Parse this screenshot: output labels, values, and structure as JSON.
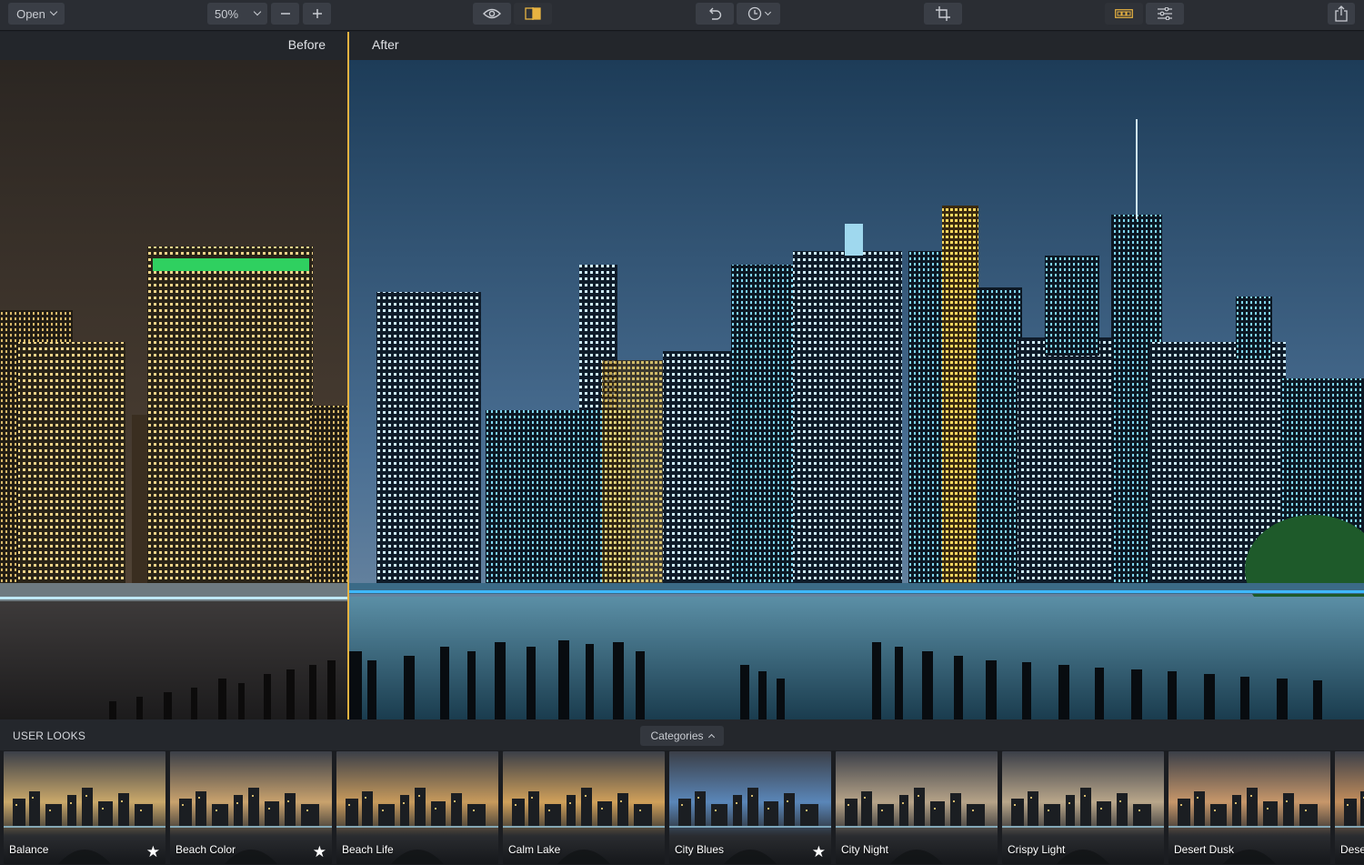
{
  "toolbar": {
    "open_label": "Open",
    "zoom_value": "50%",
    "minus_glyph": "—",
    "plus_glyph": "+"
  },
  "viewer": {
    "before_label": "Before",
    "after_label": "After"
  },
  "looks": {
    "title": "USER LOOKS",
    "categories_label": "Categories",
    "items": [
      {
        "label": "Balance",
        "starred": true,
        "tint": "#caa86a"
      },
      {
        "label": "Beach Color",
        "starred": true,
        "tint": "#c9a26d"
      },
      {
        "label": "Beach Life",
        "starred": false,
        "tint": "#c79a5c"
      },
      {
        "label": "Calm Lake",
        "starred": false,
        "tint": "#d0a05a"
      },
      {
        "label": "City Blues",
        "starred": true,
        "tint": "#5a86b8"
      },
      {
        "label": "City Night",
        "starred": false,
        "tint": "#b6a388"
      },
      {
        "label": "Crispy Light",
        "starred": false,
        "tint": "#b9a68a"
      },
      {
        "label": "Desert Dusk",
        "starred": false,
        "tint": "#c7976a"
      },
      {
        "label": "Dese",
        "starred": false,
        "tint": "#c28d5c"
      }
    ]
  },
  "icons": {
    "eye": "eye-icon",
    "compare": "split-compare-icon",
    "undo": "undo-icon",
    "history": "clock-icon",
    "crop": "crop-icon",
    "looks": "filmstrip-icon",
    "adjust": "sliders-icon",
    "share": "share-icon"
  },
  "colors": {
    "accent": "#e8b341",
    "toolbar_bg": "#2a2d33",
    "panel_bg": "#1f2228"
  }
}
